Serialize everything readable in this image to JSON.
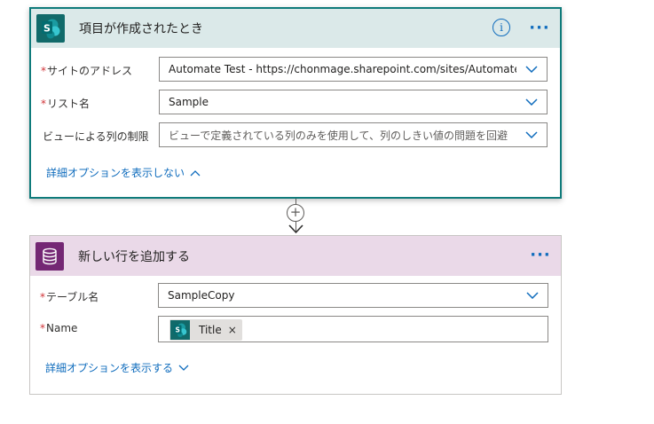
{
  "trigger_card": {
    "title": "項目が作成されたとき",
    "info_icon_text": "i",
    "more_label": "···",
    "fields": [
      {
        "required": true,
        "label": "サイトのアドレス",
        "value": "Automate Test - https://chonmage.sharepoint.com/sites/AutomateTest"
      },
      {
        "required": true,
        "label": "リスト名",
        "value": "Sample"
      },
      {
        "required": false,
        "label": "ビューによる列の制限",
        "value": "ビューで定義されている列のみを使用して、列のしきい値の問題を回避"
      }
    ],
    "advanced_link": "詳細オプションを表示しない"
  },
  "connector": {
    "add_symbol": "+"
  },
  "action_card": {
    "title": "新しい行を追加する",
    "more_label": "···",
    "fields": [
      {
        "required": true,
        "label": "テーブル名",
        "value": "SampleCopy"
      },
      {
        "required": true,
        "label": "Name",
        "token_label": "Title",
        "token_remove": "×"
      }
    ],
    "advanced_link": "詳細オプションを表示する"
  },
  "icons": {
    "trigger_app": "sharepoint-icon",
    "action_app": "dataverse-icon",
    "token_app": "sharepoint-icon"
  },
  "colors": {
    "trigger_accent": "#116a6a",
    "trigger_header_bg": "#dbe9e9",
    "action_accent": "#742774",
    "action_header_bg": "#ead9e8",
    "link": "#0f6cbd",
    "required": "#d13438"
  }
}
